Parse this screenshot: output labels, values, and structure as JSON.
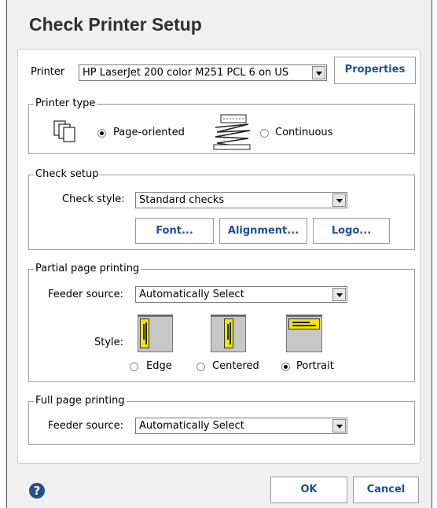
{
  "title": "Check Printer Setup",
  "printer": {
    "label": "Printer",
    "selected": "HP LaserJet 200 color M251 PCL 6 on US",
    "properties_button": "Properties"
  },
  "printer_type": {
    "title": "Printer type",
    "options": [
      "Page-oriented",
      "Continuous"
    ],
    "selected": "Page-oriented"
  },
  "check_setup": {
    "title": "Check setup",
    "style_label": "Check style:",
    "style_value": "Standard checks",
    "buttons": [
      "Font...",
      "Alignment...",
      "Logo..."
    ]
  },
  "partial_page": {
    "title": "Partial page printing",
    "feeder_label": "Feeder source:",
    "feeder_value": "Automatically Select",
    "style_label": "Style:",
    "options": [
      "Edge",
      "Centered",
      "Portrait"
    ],
    "selected": "Portrait"
  },
  "full_page": {
    "title": "Full page printing",
    "feeder_label": "Feeder source:",
    "feeder_value": "Automatically Select"
  },
  "footer": {
    "help_icon": "?",
    "ok": "OK",
    "cancel": "Cancel"
  },
  "colors": {
    "accent_text": "#1d4f9a",
    "check_yellow": "#f3e600",
    "help_icon": "#234f8e"
  }
}
